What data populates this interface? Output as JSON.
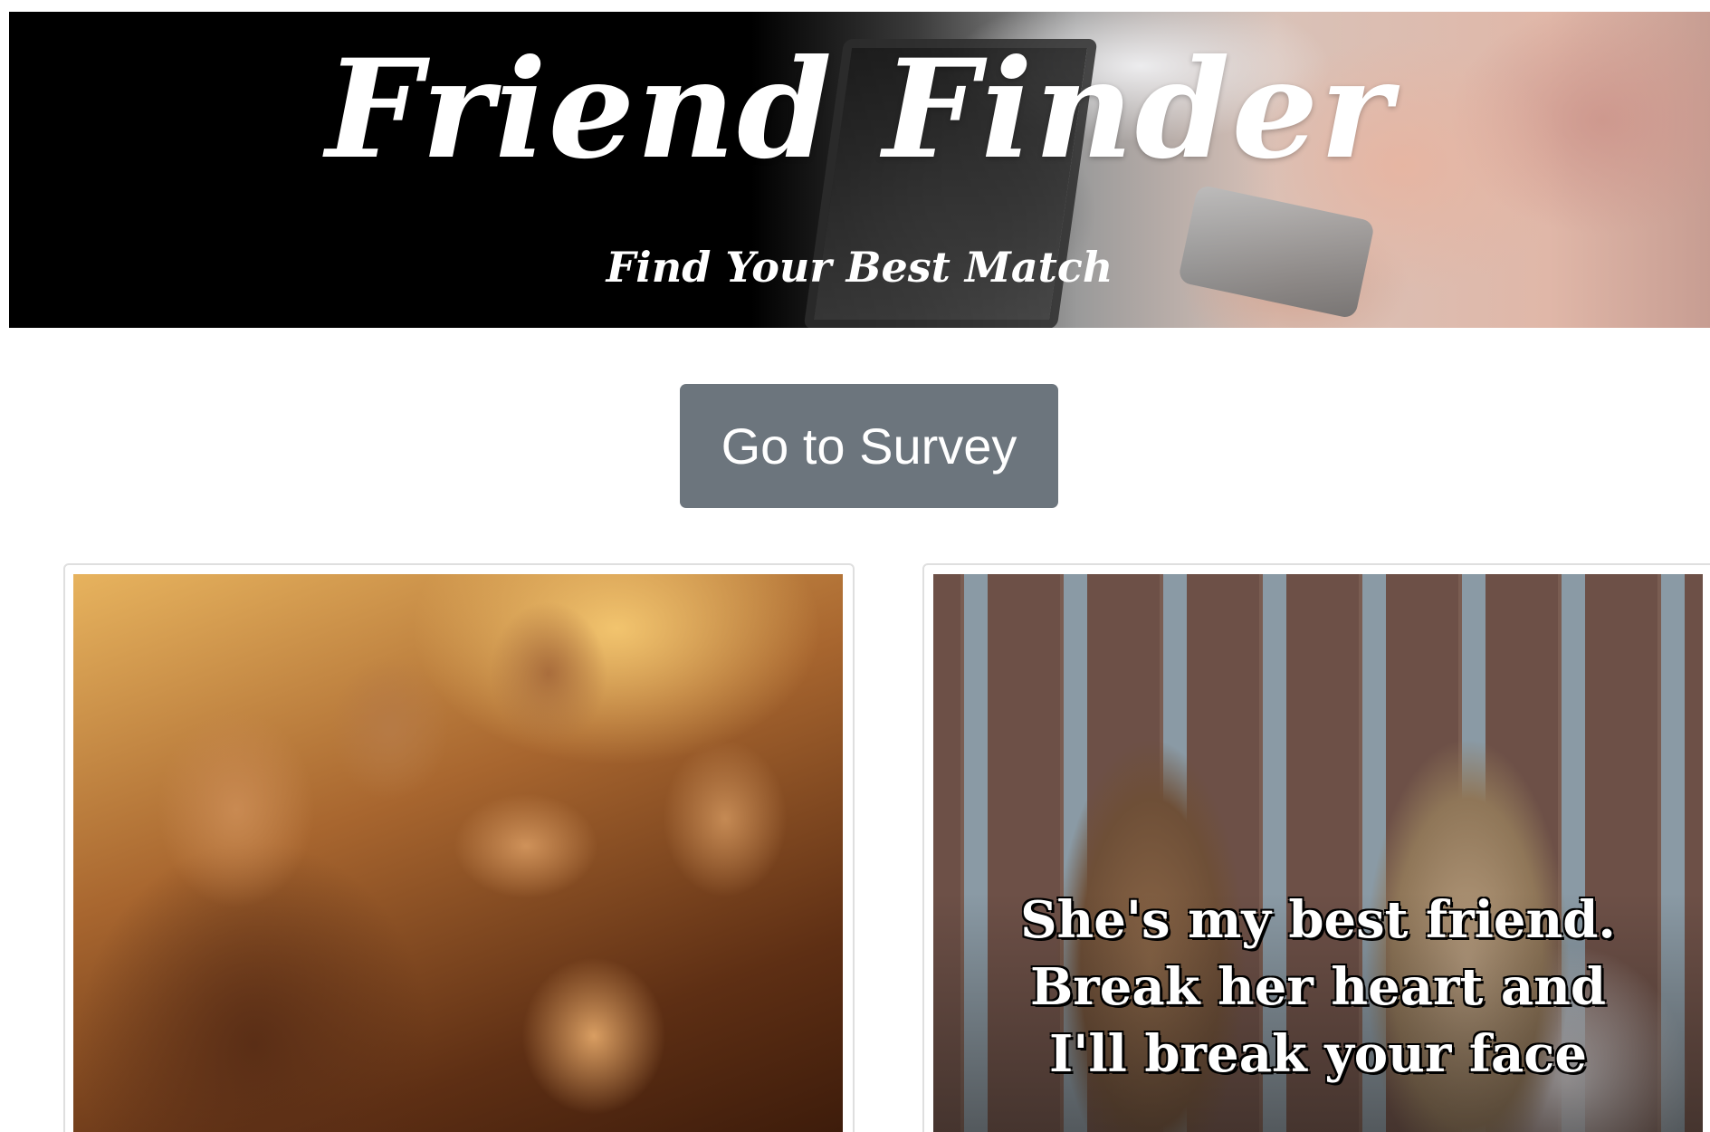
{
  "header": {
    "title": "Friend Finder",
    "subtitle": "Find Your Best Match"
  },
  "actions": {
    "survey_button_label": "Go to Survey"
  },
  "cards": [
    {
      "image_name": "group-selfie-image"
    },
    {
      "image_name": "best-friends-image",
      "caption_lines": [
        "She's my best friend.",
        "Break her heart and",
        "I'll break your face"
      ]
    }
  ],
  "colors": {
    "button_bg": "#6c757d",
    "button_text": "#ffffff",
    "banner_text": "#ffffff",
    "card_border": "#dfdfdf",
    "page_bg": "#ffffff"
  }
}
